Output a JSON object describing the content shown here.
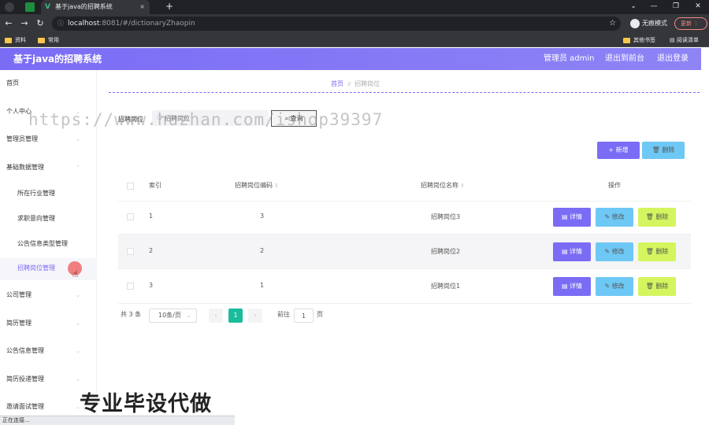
{
  "browser": {
    "tab_title": "基于java的招聘系统",
    "url_host": "localhost",
    "url_rest": ":8081/#/dictionaryZhaopin",
    "incognito_label": "无痕模式",
    "update_label": "更新",
    "bookmarks": [
      "资料",
      "常用"
    ],
    "other_bookmarks": "其他书签",
    "reading_list": "阅读清单",
    "status": "正在连接..."
  },
  "header": {
    "title": "基于java的招聘系统",
    "admin": "管理员 admin",
    "back_front": "退出到前台",
    "logout": "退出登录",
    "gradient": [
      "#7b6cf6",
      "#8e84f5"
    ]
  },
  "sidebar": {
    "items": [
      {
        "label": "首页"
      },
      {
        "label": "个人中心"
      },
      {
        "label": "管理员管理"
      },
      {
        "label": "基础数据管理"
      },
      {
        "label": "所在行业管理"
      },
      {
        "label": "求职意向管理"
      },
      {
        "label": "公告信息类型管理"
      },
      {
        "label": "招聘岗位管理"
      },
      {
        "label": "公司管理"
      },
      {
        "label": "简历管理"
      },
      {
        "label": "公告信息管理"
      },
      {
        "label": "简历投递管理"
      },
      {
        "label": "邀请面试管理"
      }
    ]
  },
  "breadcrumb": {
    "home": "首页",
    "current": "招聘岗位"
  },
  "search": {
    "label": "招聘岗位",
    "placeholder": "招聘岗位",
    "button": "查询"
  },
  "actions": {
    "add": "新增",
    "delete": "删除"
  },
  "table": {
    "headers": [
      "索引",
      "招聘岗位编码",
      "招聘岗位名称",
      "操作"
    ],
    "rows": [
      {
        "index": "1",
        "code": "3",
        "name": "招聘岗位3"
      },
      {
        "index": "2",
        "code": "2",
        "name": "招聘岗位2"
      },
      {
        "index": "3",
        "code": "1",
        "name": "招聘岗位1"
      }
    ],
    "row_buttons": {
      "detail": "详情",
      "edit": "修改",
      "delete": "删除"
    }
  },
  "pagination": {
    "total": "共 3 条",
    "page_size": "10条/页",
    "current_page": "1",
    "goto_prefix": "前往",
    "goto_value": "1",
    "goto_suffix": "页"
  },
  "overlay": {
    "watermark": "https://www.huzhan.com/ishop39397",
    "promo": "专业毕设代做"
  },
  "colors": {
    "accent": "#7b6cf6",
    "info": "#6ec8f5",
    "warning": "#d4f55e",
    "pager_active": "#1abc9c"
  }
}
